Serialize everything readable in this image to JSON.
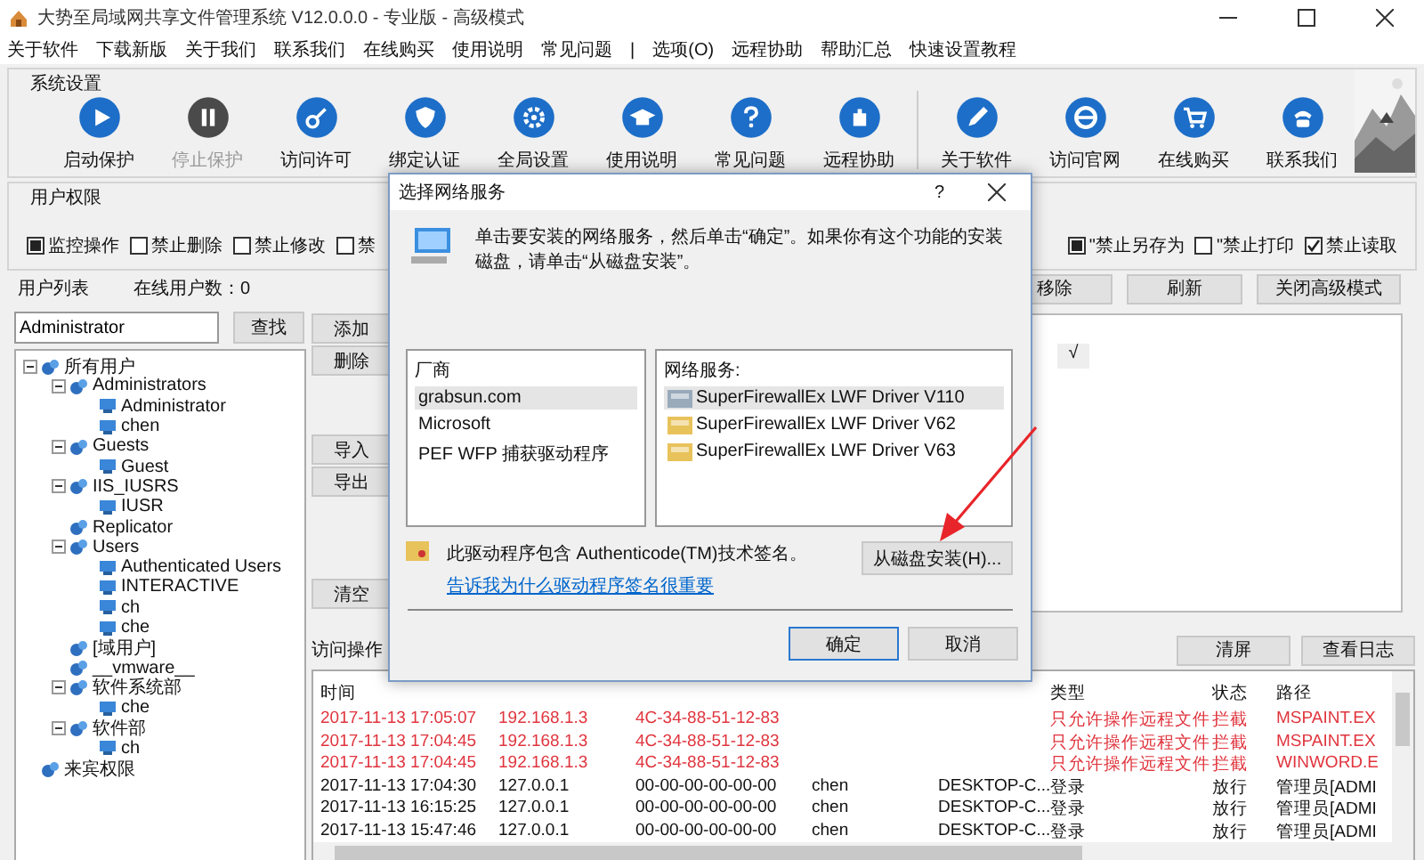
{
  "window": {
    "title": "大势至局域网共享文件管理系统 V12.0.0.0 - 专业版 - 高级模式"
  },
  "menu": [
    "关于软件",
    "下载新版",
    "关于我们",
    "联系我们",
    "在线购买",
    "使用说明",
    "常见问题",
    "|",
    "选项(O)",
    "远程协助",
    "帮助汇总",
    "快速设置教程"
  ],
  "toolbar": {
    "title": "系统设置",
    "groups": [
      [
        {
          "label": "启动保护",
          "disabled": false
        },
        {
          "label": "停止保护",
          "disabled": true
        },
        {
          "label": "访问许可",
          "disabled": false
        },
        {
          "label": "绑定认证",
          "disabled": false
        },
        {
          "label": "全局设置",
          "disabled": false
        },
        {
          "label": "使用说明",
          "disabled": false
        },
        {
          "label": "常见问题",
          "disabled": false
        },
        {
          "label": "远程协助",
          "disabled": false
        }
      ],
      [
        {
          "label": "关于软件",
          "disabled": false
        },
        {
          "label": "访问官网",
          "disabled": false
        },
        {
          "label": "在线购买",
          "disabled": false
        },
        {
          "label": "联系我们",
          "disabled": false
        }
      ]
    ]
  },
  "permissions": {
    "title": "用户权限",
    "left": [
      {
        "label": "监控操作",
        "checked": true,
        "mixed": true
      },
      {
        "label": "禁止删除",
        "checked": false,
        "mixed": false
      },
      {
        "label": "禁止修改",
        "checked": false,
        "mixed": false
      },
      {
        "label": "禁",
        "checked": false,
        "mixed": false
      }
    ],
    "right": [
      {
        "label": "\"禁止另存为",
        "checked": true,
        "mixed": true
      },
      {
        "label": "\"禁止打印",
        "checked": false,
        "mixed": false
      },
      {
        "label": "禁止读取",
        "checked": true,
        "mixed": false
      }
    ]
  },
  "user_list": {
    "label": "用户列表",
    "online": "在线用户数：0",
    "search": {
      "value": "Administrator"
    },
    "search_button": "查找",
    "tree": [
      {
        "label": "所有用户",
        "kind": "group",
        "expanded": true,
        "children": [
          {
            "label": "Administrators",
            "kind": "group",
            "expanded": true,
            "children": [
              {
                "label": "Administrator",
                "kind": "user"
              },
              {
                "label": "chen",
                "kind": "user"
              }
            ]
          },
          {
            "label": "Guests",
            "kind": "group",
            "expanded": true,
            "children": [
              {
                "label": "Guest",
                "kind": "user"
              }
            ]
          },
          {
            "label": "IIS_IUSRS",
            "kind": "group",
            "expanded": true,
            "children": [
              {
                "label": "IUSR",
                "kind": "user"
              }
            ]
          },
          {
            "label": "Replicator",
            "kind": "group"
          },
          {
            "label": "Users",
            "kind": "group",
            "expanded": true,
            "children": [
              {
                "label": "Authenticated Users",
                "kind": "user"
              },
              {
                "label": "INTERACTIVE",
                "kind": "user"
              },
              {
                "label": "ch",
                "kind": "user"
              },
              {
                "label": "che",
                "kind": "user"
              }
            ]
          },
          {
            "label": "[域用户]",
            "kind": "group"
          },
          {
            "label": "__vmware__",
            "kind": "group"
          },
          {
            "label": "软件系统部",
            "kind": "group",
            "expanded": true,
            "children": [
              {
                "label": "che",
                "kind": "user"
              }
            ]
          },
          {
            "label": "软件部",
            "kind": "group",
            "expanded": true,
            "children": [
              {
                "label": "ch",
                "kind": "user"
              }
            ]
          }
        ]
      },
      {
        "label": "来宾权限",
        "kind": "group"
      }
    ]
  },
  "list_buttons": [
    "移除",
    "刷新",
    "关闭高级模式"
  ],
  "side_buttons": [
    [
      "添加",
      "删除"
    ],
    [
      "导入",
      "导出"
    ],
    [
      "清空"
    ]
  ],
  "rule_mark": "√",
  "log": {
    "title": "访问操作",
    "buttons": [
      "清屏",
      "查看日志"
    ],
    "columns": [
      "时间",
      "类型",
      "状态",
      "路径"
    ],
    "rows": [
      {
        "alert": true,
        "time": "2017-11-13 17:05:07",
        "ip": "192.168.1.3",
        "mac": "4C-34-88-51-12-83",
        "type": "只允许操作远程文件",
        "status": "拦截",
        "path": "MSPAINT.EX"
      },
      {
        "alert": true,
        "time": "2017-11-13 17:04:45",
        "ip": "192.168.1.3",
        "mac": "4C-34-88-51-12-83",
        "type": "只允许操作远程文件",
        "status": "拦截",
        "path": "MSPAINT.EX"
      },
      {
        "alert": true,
        "time": "2017-11-13 17:04:45",
        "ip": "192.168.1.3",
        "mac": "4C-34-88-51-12-83",
        "type": "只允许操作远程文件",
        "status": "拦截",
        "path": "WINWORD.E"
      },
      {
        "alert": false,
        "time": "2017-11-13 17:04:30",
        "ip": "127.0.0.1",
        "mac": "00-00-00-00-00-00",
        "user": "chen",
        "computer": "DESKTOP-C...",
        "type": "登录",
        "status": "放行",
        "path": "管理员[ADMI"
      },
      {
        "alert": false,
        "time": "2017-11-13 16:15:25",
        "ip": "127.0.0.1",
        "mac": "00-00-00-00-00-00",
        "user": "chen",
        "computer": "DESKTOP-C...",
        "type": "登录",
        "status": "放行",
        "path": "管理员[ADMI"
      },
      {
        "alert": false,
        "time": "2017-11-13 15:47:46",
        "ip": "127.0.0.1",
        "mac": "00-00-00-00-00-00",
        "user": "chen",
        "computer": "DESKTOP-C...",
        "type": "登录",
        "status": "放行",
        "path": "管理员[ADMI"
      }
    ]
  },
  "dialog": {
    "title": "选择网络服务",
    "help": "?",
    "message": "单击要安装的网络服务，然后单击“确定”。如果你有这个功能的安装磁盘，请单击“从磁盘安装”。",
    "vendors": {
      "header": "厂商",
      "items": [
        {
          "label": "grabsun.com",
          "selected": true
        },
        {
          "label": "Microsoft",
          "selected": false
        },
        {
          "label": "PEF WFP 捕获驱动程序",
          "selected": false
        }
      ]
    },
    "services": {
      "header": "网络服务:",
      "items": [
        {
          "label": "SuperFirewallEx LWF Driver V110",
          "selected": true
        },
        {
          "label": "SuperFirewallEx LWF Driver V62",
          "selected": false
        },
        {
          "label": "SuperFirewallEx LWF Driver V63",
          "selected": false
        }
      ]
    },
    "signature": "此驱动程序包含 Authenticode(TM)技术签名。",
    "link": "告诉我为什么驱动程序签名很重要",
    "disk_button": "从磁盘安装(H)...",
    "ok": "确定",
    "cancel": "取消"
  }
}
